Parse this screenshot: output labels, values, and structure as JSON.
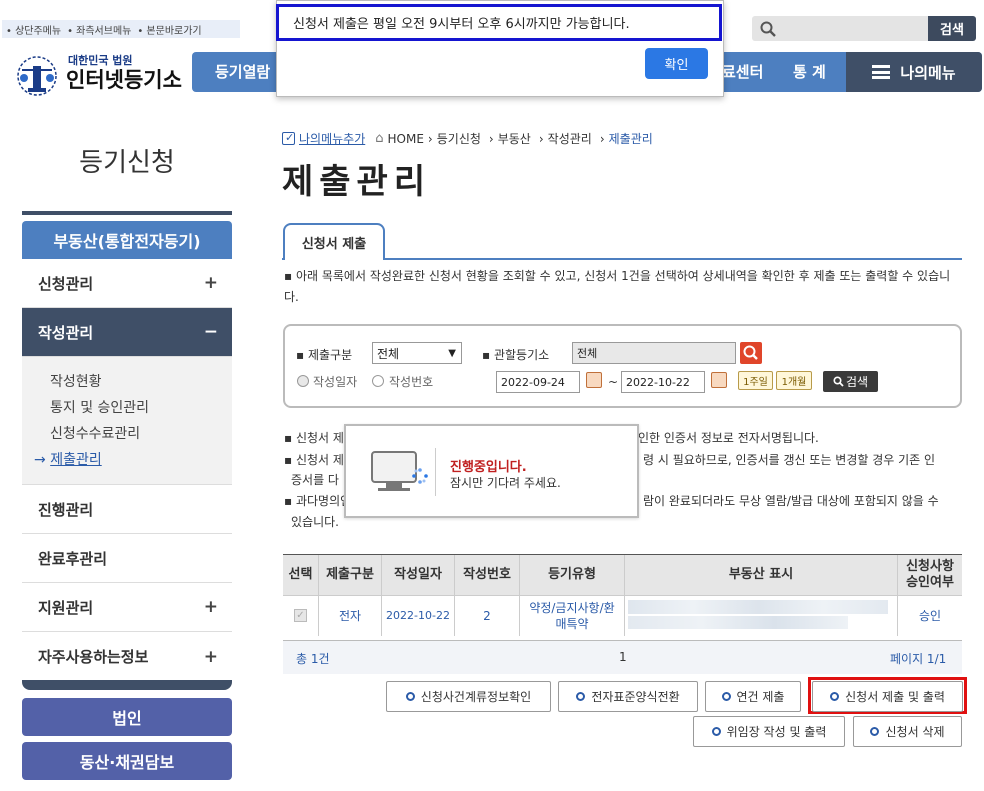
{
  "skip_links": [
    "• 상단주메뉴",
    "• 좌측서브메뉴",
    "• 본문바로가기"
  ],
  "logo": {
    "subtitle": "대한민국 법원",
    "title": "인터넷등기소"
  },
  "nav": {
    "items": [
      "등기열람",
      "료센터",
      "통 계"
    ],
    "my_menu": "나의메뉴"
  },
  "search": {
    "button": "검색",
    "placeholder": ""
  },
  "popup": {
    "message": "신청서 제출은 평일 오전 9시부터 오후 6시까지만 가능합니다.",
    "ok": "확인"
  },
  "sidebar": {
    "title": "등기신청",
    "header": "부동산(통합전자등기)",
    "items": [
      "신청관리",
      "작성관리",
      "진행관리",
      "완료후관리",
      "지원관리",
      "자주사용하는정보"
    ],
    "sub_items": [
      "작성현황",
      "통지 및 승인관리",
      "신청수수료관리",
      "제출관리"
    ],
    "buttons": [
      "법인",
      "동산·채권담보"
    ]
  },
  "breadcrumb": {
    "my_menu_add": "나의메뉴추가",
    "path": [
      "HOME",
      "등기신청",
      "부동산",
      "작성관리",
      "제출관리"
    ]
  },
  "page_title": "제출관리",
  "tab": "신청서 제출",
  "intro": "아래 목록에서 작성완료한 신청서 현황을 조회할 수 있고, 신청서 1건을 선택하여 상세내역을 확인한 후 제출 또는 출력할 수 있습니다.",
  "filter": {
    "submit_type_label": "제출구분",
    "submit_type_value": "전체",
    "court_label": "관할등기소",
    "court_value": "전체",
    "date_radio": "작성일자",
    "number_radio": "작성번호",
    "date_from": "2022-09-24",
    "date_to": "2022-10-22",
    "tilde": "~",
    "week": "1주일",
    "month": "1개월",
    "search": "검색"
  },
  "notes": [
    "신청서 제",
    "인한 인증서 정보로 전자서명됩니다.",
    "신청서 제",
    "령 시 필요하므로, 인증서를 갱신 또는 변경할 경우 기존 인",
    "증서를 다",
    "과다명의인",
    "람이 완료되더라도 무상 열람/발급 대상에 포함되지 않을 수",
    "있습니다."
  ],
  "loading": {
    "title": "진행중입니다.",
    "subtitle": "잠시만 기다려 주세요."
  },
  "table": {
    "headers": [
      "선택",
      "제출구분",
      "작성일자",
      "작성번호",
      "등기유형",
      "부동산 표시",
      "신청사항\n승인여부"
    ],
    "rows": [
      {
        "submit_type": "전자",
        "date": "2022-10-22",
        "number": "2",
        "type": "약정/금지사항/환매특약",
        "approval": "승인"
      }
    ],
    "total": "총 1건",
    "page_num": "1",
    "page": "페이지 1/1"
  },
  "actions": [
    "신청사건계류정보확인",
    "전자표준양식전환",
    "연건 제출",
    "신청서 제출 및 출력",
    "위임장 작성 및 출력",
    "신청서 삭제"
  ]
}
